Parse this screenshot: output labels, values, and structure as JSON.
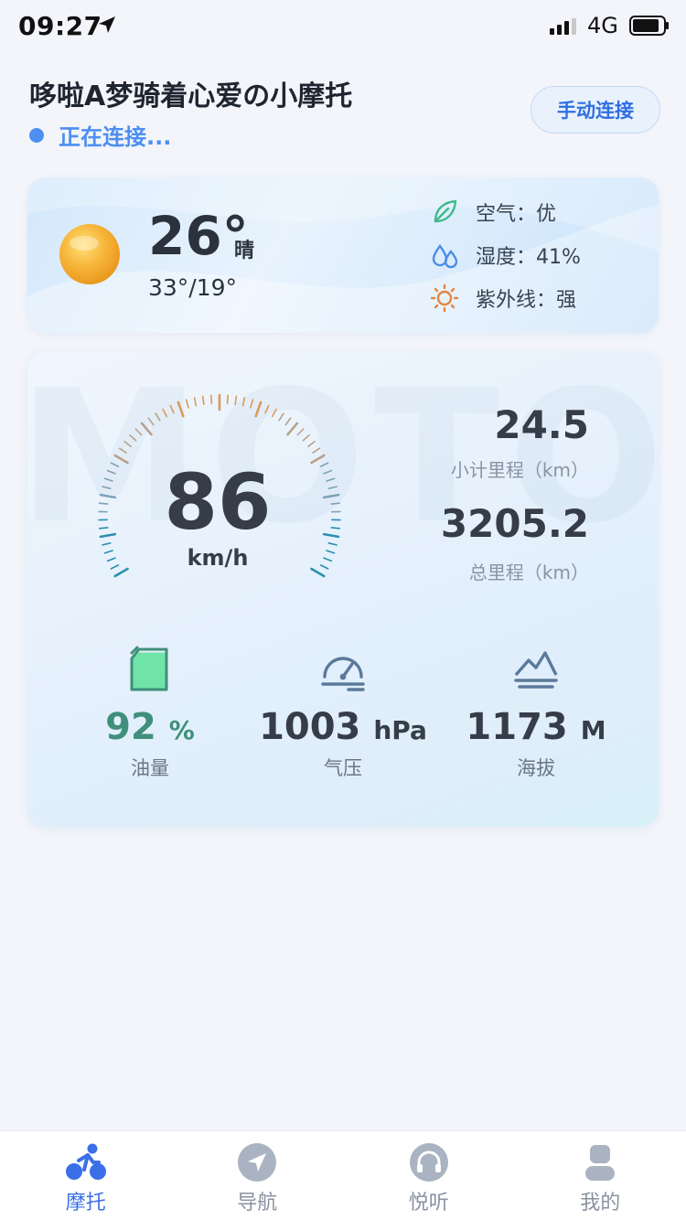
{
  "status_bar": {
    "time": "09:27",
    "network": "4G"
  },
  "header": {
    "device_name": "哆啦A梦骑着心爱の小摩托",
    "connection_status": "正在连接...",
    "connect_button": "手动连接"
  },
  "weather": {
    "temperature": "26°",
    "condition": "晴",
    "range": "33°/19°",
    "air_quality": "空气：优",
    "humidity": "湿度：41%",
    "uv": "紫外线：强"
  },
  "dashboard": {
    "watermark": "MOTOR",
    "speed": "86",
    "speed_unit": "km/h",
    "trip_value": "24.5",
    "trip_label": "小计里程（km）",
    "odometer_value": "3205.2",
    "odometer_label": "总里程（km）",
    "fuel_value": "92",
    "fuel_unit": "%",
    "fuel_level": 0.92,
    "fuel_label": "油量",
    "pressure_value": "1003",
    "pressure_unit": "hPa",
    "pressure_label": "气压",
    "altitude_value": "1173",
    "altitude_unit": "M",
    "altitude_label": "海拔"
  },
  "tabs": [
    {
      "label": "摩托",
      "icon": "motorbike-icon",
      "active": true
    },
    {
      "label": "导航",
      "icon": "navigation-icon",
      "active": false
    },
    {
      "label": "悦听",
      "icon": "headphones-icon",
      "active": false
    },
    {
      "label": "我的",
      "icon": "user-icon",
      "active": false
    }
  ],
  "colors": {
    "accent": "#3a6fe8",
    "connecting": "#4d8ff0",
    "fuel": "#3f8f7a"
  }
}
